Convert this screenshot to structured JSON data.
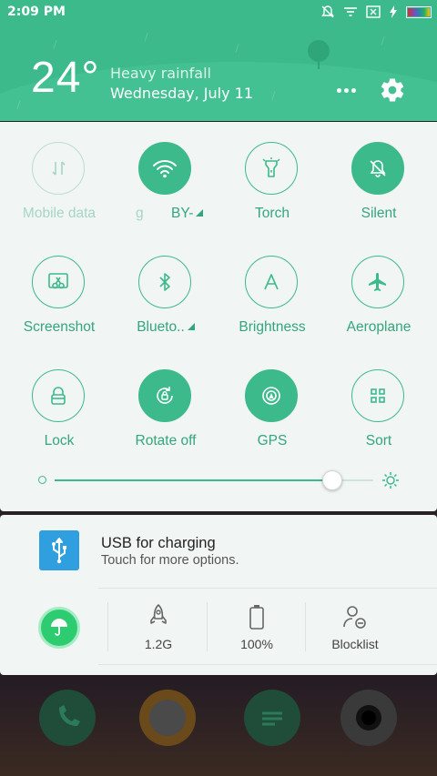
{
  "status_bar": {
    "time": "2:09 PM",
    "icons": [
      "mute-notifications-icon",
      "signal-icon",
      "no-sim-icon",
      "charging-icon",
      "battery-icon"
    ]
  },
  "header": {
    "temperature": "24°",
    "weather": "Heavy rainfall",
    "date": "Wednesday, July 11",
    "more_icon": "more-dots-icon",
    "settings_icon": "gear-icon"
  },
  "toggles": [
    {
      "label": "Mobile data",
      "icon": "data-arrows-icon",
      "state": "disabled"
    },
    {
      "label": "BY-",
      "ghost_label": "g",
      "icon": "wifi-icon",
      "state": "on"
    },
    {
      "label": "Torch",
      "icon": "torch-icon",
      "state": "off"
    },
    {
      "label": "Silent",
      "icon": "bell-off-icon",
      "state": "on"
    },
    {
      "label": "Screenshot",
      "icon": "scissors-icon",
      "state": "off"
    },
    {
      "label": "Blueto..",
      "icon": "bluetooth-icon",
      "state": "off"
    },
    {
      "label": "Brightness",
      "icon": "letter-a-icon",
      "state": "off"
    },
    {
      "label": "Aeroplane",
      "icon": "airplane-icon",
      "state": "off"
    },
    {
      "label": "Lock",
      "icon": "lock-icon",
      "state": "off"
    },
    {
      "label": "Rotate off",
      "icon": "rotate-lock-icon",
      "state": "on"
    },
    {
      "label": "GPS",
      "icon": "gps-icon",
      "state": "on"
    },
    {
      "label": "Sort",
      "icon": "grid-icon",
      "state": "off"
    }
  ],
  "brightness": {
    "level": 0.87
  },
  "notification": {
    "title": "USB for charging",
    "subtitle": "Touch for more options."
  },
  "quick_stats": [
    {
      "icon": "rocket-icon",
      "value": "1.2G"
    },
    {
      "icon": "battery-outline-icon",
      "value": "100%"
    },
    {
      "icon": "blocklist-user-icon",
      "value": "Blocklist"
    }
  ],
  "colors": {
    "accent": "#3cba8b",
    "header_bg": "#3cba8b",
    "panel_bg": "#f1f5f4",
    "usb_blue": "#2f9fe0"
  }
}
